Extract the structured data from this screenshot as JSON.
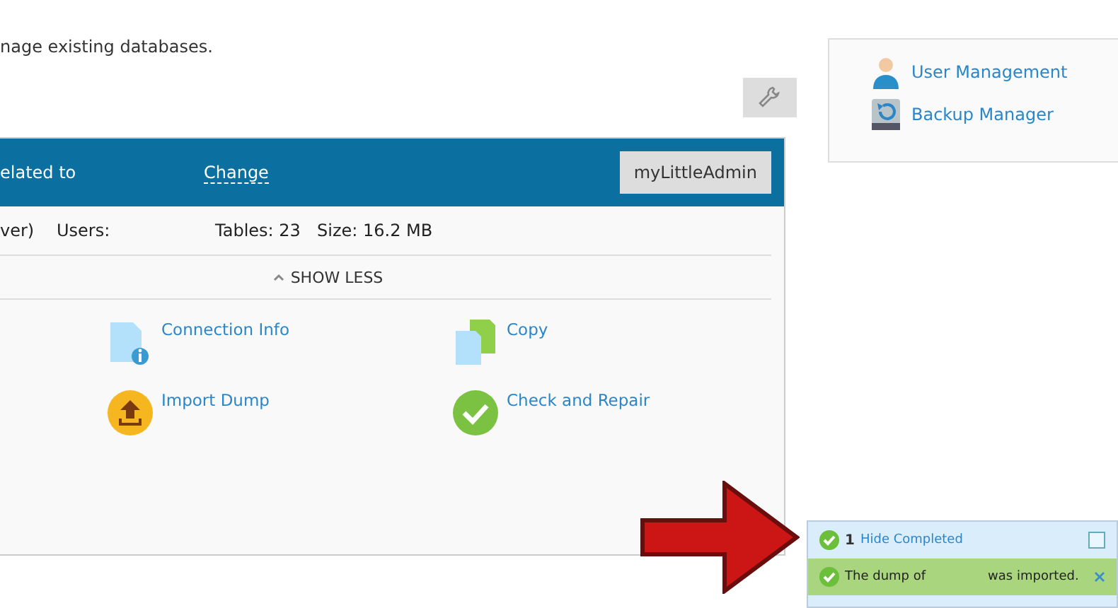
{
  "intro": "nage existing databases.",
  "header": {
    "label": "elated to",
    "link": "Change",
    "button": "myLittleAdmin"
  },
  "info": [
    {
      "label": "ver)"
    },
    {
      "label": "Users:"
    },
    {
      "label": "Tables:",
      "value": "23"
    },
    {
      "label": "Size:",
      "value": "16.2 MB"
    }
  ],
  "toggle": "SHOW LESS",
  "actions": [
    {
      "label": "Connection Info",
      "kind": "info"
    },
    {
      "label": "Copy",
      "kind": "copy"
    },
    {
      "label": "Import Dump",
      "kind": "import"
    },
    {
      "label": "Check and Repair",
      "kind": "check"
    }
  ],
  "sidebar": {
    "items": [
      {
        "label": "User Management",
        "kind": "user"
      },
      {
        "label": "Backup Manager",
        "kind": "backup"
      }
    ]
  },
  "notifications": {
    "count": "1",
    "toggle": "Hide Completed",
    "items": [
      {
        "before": "The dump of",
        "after": "was imported."
      }
    ]
  }
}
